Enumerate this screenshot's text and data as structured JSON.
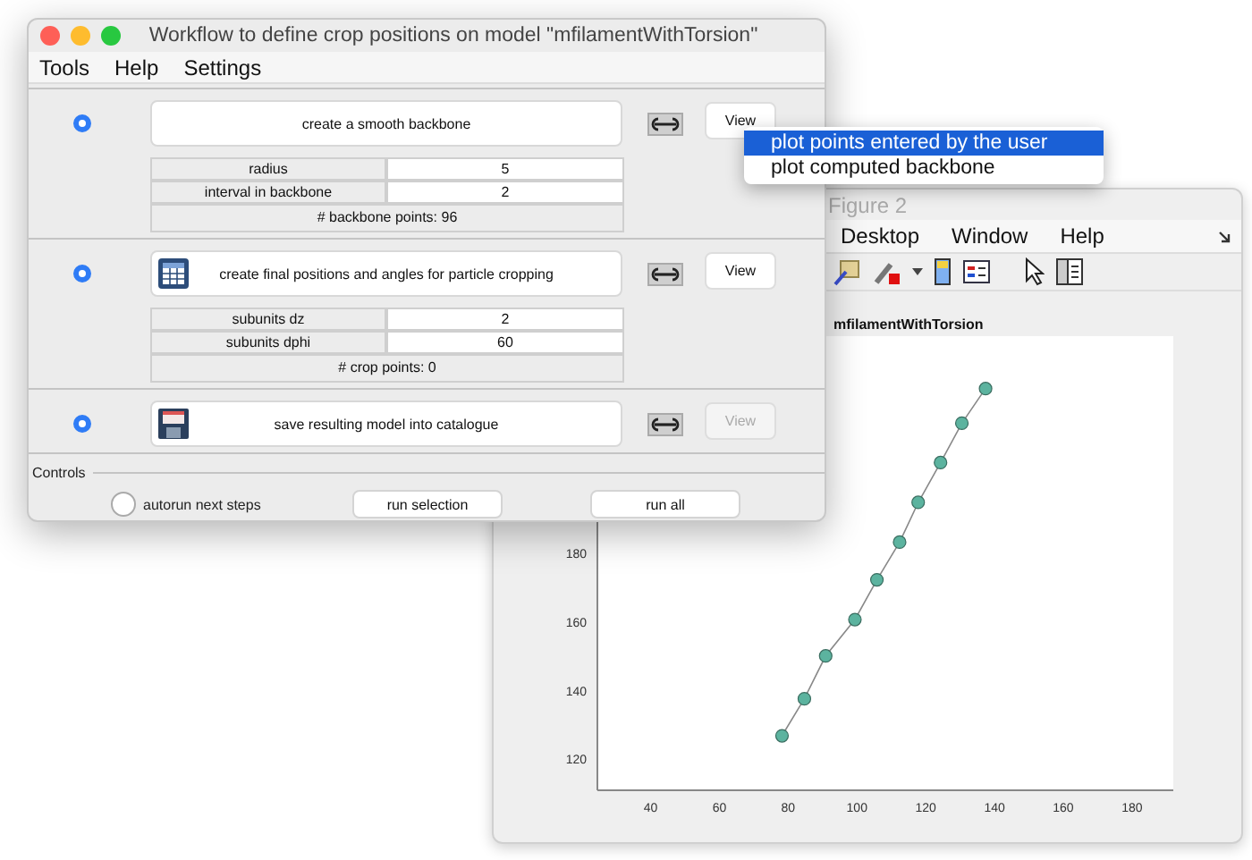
{
  "figure_window": {
    "title": "Figure 2",
    "menu": [
      "Desktop",
      "Window",
      "Help"
    ],
    "axes_title": "mfilamentWithTorsion",
    "chart_data": {
      "type": "line",
      "x": [
        78.2,
        84.7,
        90.9,
        99.4,
        105.8,
        112.4,
        117.8,
        124.3,
        130.5,
        137.4
      ],
      "series": [
        {
          "color": "#5cb39f",
          "marker": "o",
          "values": [
            126.9,
            137.7,
            150.2,
            160.8,
            172.4,
            183.4,
            195,
            206.6,
            218.1,
            228.2
          ]
        }
      ],
      "xlim": [
        24.5,
        192
      ],
      "ylim": [
        111,
        243.5
      ],
      "xticks": [
        40,
        60,
        80,
        100,
        120,
        140,
        160,
        180
      ],
      "yticks": [
        120,
        140,
        160,
        180
      ]
    }
  },
  "main_window": {
    "title": "Workflow to define crop positions on model \"mfilamentWithTorsion\"",
    "menu": [
      "Tools",
      "Help",
      "Settings"
    ],
    "steps": [
      {
        "selected": true,
        "label": "create a smooth backbone",
        "view_button": {
          "label": "View",
          "disabled": false
        },
        "params": [
          {
            "label": "radius",
            "value": "5"
          },
          {
            "label": "interval in backbone",
            "value": "2"
          }
        ],
        "summary": "# backbone points: 96"
      },
      {
        "selected": true,
        "kind": "table",
        "label": "create final positions and angles for particle cropping",
        "view_button": {
          "label": "View",
          "disabled": false
        },
        "params": [
          {
            "label": "subunits dz",
            "value": "2"
          },
          {
            "label": "subunits dphi",
            "value": "60"
          }
        ],
        "summary": "# crop points: 0"
      },
      {
        "selected": true,
        "kind": "floppy",
        "label": "save resulting model into catalogue",
        "view_button": {
          "label": "View",
          "disabled": true
        }
      }
    ],
    "controls": {
      "title": "Controls",
      "autorun": {
        "label": "autorun next steps",
        "selected": false
      },
      "buttons": [
        "run selection",
        "run all"
      ]
    }
  },
  "popup_menu": {
    "items": [
      {
        "label": "plot points entered by the user",
        "selected": true
      },
      {
        "label": "plot computed backbone",
        "selected": false
      }
    ]
  }
}
